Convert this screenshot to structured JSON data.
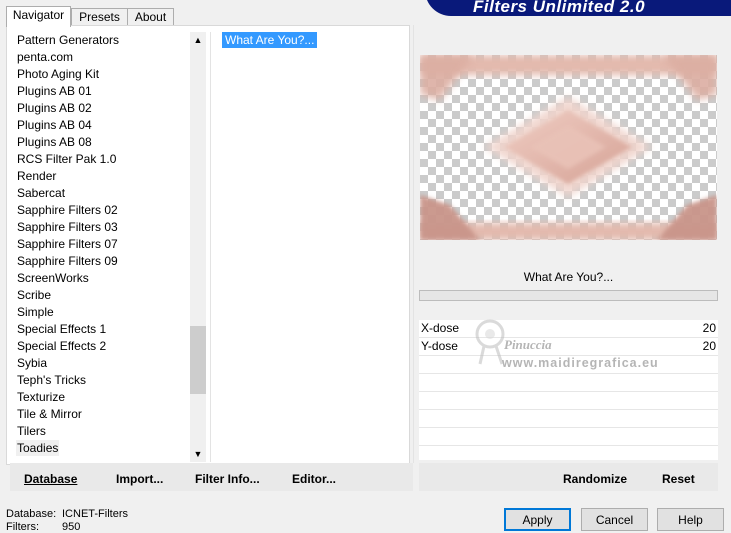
{
  "tabs": [
    {
      "label": "Navigator",
      "active": true
    },
    {
      "label": "Presets",
      "active": false
    },
    {
      "label": "About",
      "active": false
    }
  ],
  "banner": {
    "title": "Filters Unlimited 2.0"
  },
  "filter_list": {
    "items": [
      "Pattern Generators",
      "penta.com",
      "Photo Aging Kit",
      "Plugins AB 01",
      "Plugins AB 02",
      "Plugins AB 04",
      "Plugins AB 08",
      "RCS Filter Pak 1.0",
      "Render",
      "Sabercat",
      "Sapphire Filters 02",
      "Sapphire Filters 03",
      "Sapphire Filters 07",
      "Sapphire Filters 09",
      "ScreenWorks",
      "Scribe",
      "Simple",
      "Special Effects 1",
      "Special Effects 2",
      "Sybia",
      "Teph's Tricks",
      "Texturize",
      "Tile & Mirror",
      "Tilers",
      "Toadies"
    ],
    "selected_index": 24,
    "icons": {
      "up": "scroll-up-arrow-icon",
      "down": "scroll-down-arrow-icon"
    }
  },
  "effect_list": {
    "items": [
      "What Are You?..."
    ],
    "selected_index": 0
  },
  "preview": {
    "effect_name": "What Are You?...",
    "accent_color": "#d9a99b"
  },
  "params": [
    {
      "label": "X-dose",
      "value": "20"
    },
    {
      "label": "Y-dose",
      "value": "20"
    }
  ],
  "watermark": {
    "line1": "Pinuccia",
    "line2": "www.maidiregrafica.eu"
  },
  "left_bar": {
    "database": "Database",
    "import": "Import...",
    "filter_info": "Filter Info...",
    "editor": "Editor..."
  },
  "right_bar": {
    "randomize": "Randomize",
    "reset": "Reset"
  },
  "status": {
    "database_label": "Database:",
    "database_value": "ICNET-Filters",
    "filters_label": "Filters:",
    "filters_value": "950"
  },
  "buttons": {
    "apply": "Apply",
    "cancel": "Cancel",
    "help": "Help"
  }
}
